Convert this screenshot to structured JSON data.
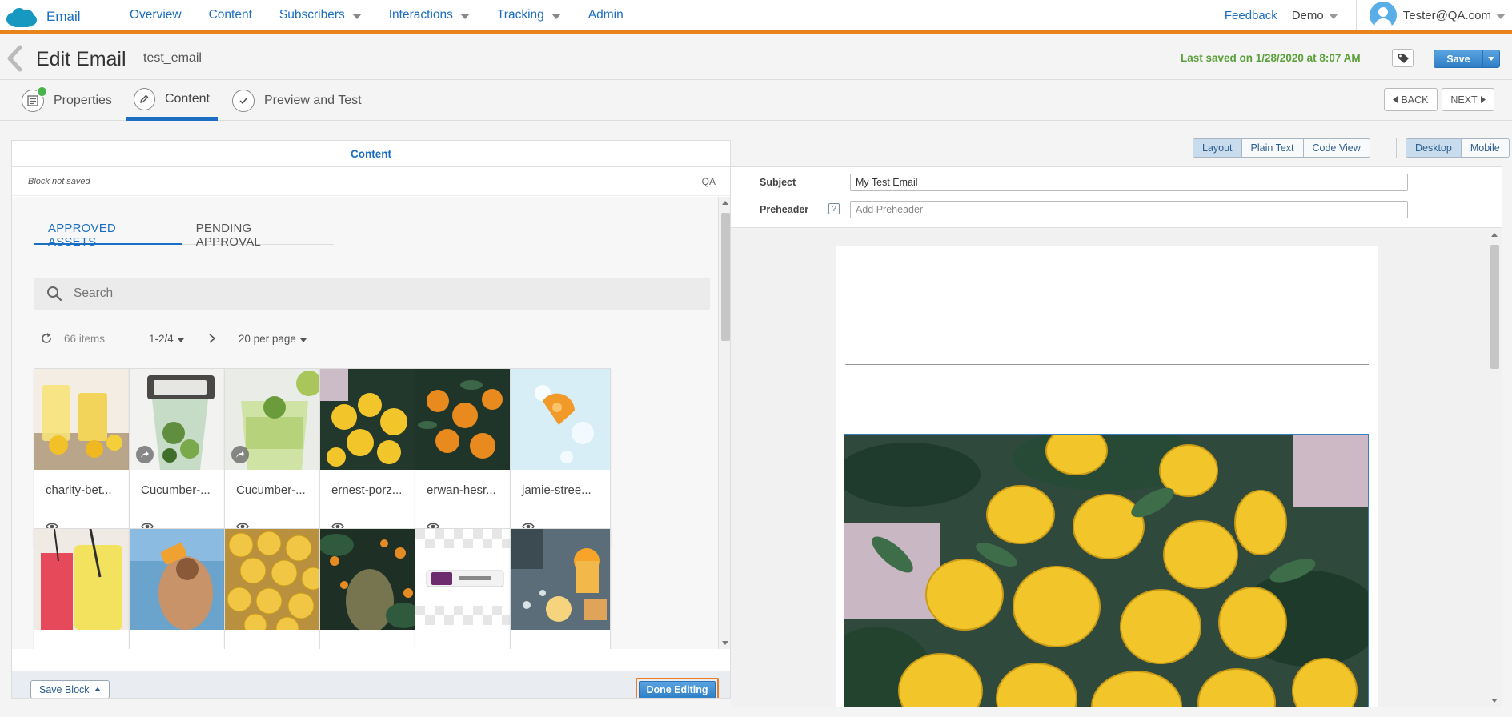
{
  "app": {
    "name": "Email"
  },
  "nav": {
    "items": [
      {
        "label": "Overview",
        "dropdown": false
      },
      {
        "label": "Content",
        "dropdown": false
      },
      {
        "label": "Subscribers",
        "dropdown": true
      },
      {
        "label": "Interactions",
        "dropdown": true
      },
      {
        "label": "Tracking",
        "dropdown": true
      },
      {
        "label": "Admin",
        "dropdown": false
      }
    ],
    "feedback": "Feedback",
    "demo": "Demo",
    "user": "Tester@QA.com"
  },
  "header": {
    "title": "Edit Email",
    "email_name": "test_email",
    "last_saved": "Last saved on 1/28/2020 at 8:07 AM",
    "save_label": "Save"
  },
  "steps": [
    {
      "label": "Properties",
      "icon": "properties-icon",
      "complete": true
    },
    {
      "label": "Content",
      "icon": "pencil-icon",
      "active": true
    },
    {
      "label": "Preview and Test",
      "icon": "check-icon"
    }
  ],
  "step_nav": {
    "back": "BACK",
    "next": "NEXT"
  },
  "content_panel": {
    "title": "Content",
    "block_status": "Block not saved",
    "owner": "QA",
    "tabs": [
      "APPROVED ASSETS",
      "PENDING APPROVAL"
    ],
    "search_placeholder": "Search",
    "item_count": "66 items",
    "page_range": "1-2/4",
    "per_page": "20 per page",
    "assets": [
      {
        "name": "charity-bet...",
        "theme": "lemonade"
      },
      {
        "name": "Cucumber-...",
        "theme": "blender"
      },
      {
        "name": "Cucumber-...",
        "theme": "limejuice"
      },
      {
        "name": "ernest-porz...",
        "theme": "lemons"
      },
      {
        "name": "erwan-hesr...",
        "theme": "oranges"
      },
      {
        "name": "jamie-stree...",
        "theme": "splash"
      },
      {
        "name": "",
        "theme": "drinks"
      },
      {
        "name": "",
        "theme": "beach"
      },
      {
        "name": "",
        "theme": "pile"
      },
      {
        "name": "",
        "theme": "orchard"
      },
      {
        "name": "",
        "theme": "bar"
      },
      {
        "name": "",
        "theme": "table"
      }
    ],
    "save_block": "Save Block",
    "done_editing": "Done Editing"
  },
  "preview": {
    "views": [
      "Layout",
      "Plain Text",
      "Code View"
    ],
    "active_view": "Layout",
    "devices": [
      "Desktop",
      "Mobile"
    ],
    "active_device": "Desktop",
    "subject_label": "Subject",
    "subject_value": "My Test Email",
    "preheader_label": "Preheader",
    "preheader_help": "?",
    "preheader_placeholder": "Add Preheader"
  },
  "colors": {
    "accent": "#1b6ec2",
    "nav_border": "#e8851a",
    "saved_green": "#5ba03a",
    "focus_orange": "#f07c22"
  }
}
